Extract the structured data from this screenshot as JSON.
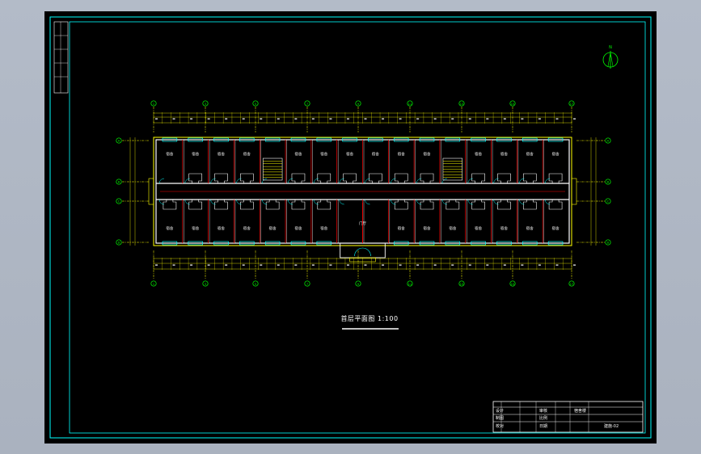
{
  "drawing": {
    "plan_title": "首层平面图 1:100",
    "room_label": "宿舍",
    "room_label_variant": "宿舍",
    "entrance_label": "门厅",
    "axis_labels": {
      "columns": [
        "1",
        "3",
        "5",
        "7",
        "9",
        "11",
        "13",
        "15",
        "17"
      ],
      "rows": [
        "A",
        "B",
        "C",
        "D"
      ]
    },
    "colors": {
      "background": "#000000",
      "frame": "#00ffff",
      "wall": "#ffffff",
      "grid_lines": "#ffff00",
      "axis_circle": "#00ff00",
      "red_lines": "#ff0000",
      "cyan_accents": "#00ffff",
      "magenta": "#ff00ff"
    }
  },
  "title_block": {
    "rows": [
      [
        "设计",
        "",
        "",
        "审核",
        "",
        "宿舍楼",
        ""
      ],
      [
        "制图",
        "",
        "",
        "比例",
        "",
        "",
        ""
      ],
      [
        "校对",
        "",
        "",
        "日期",
        "",
        "",
        ""
      ]
    ],
    "drawing_number": "建施-02"
  },
  "compass": {
    "north_label": "N"
  }
}
